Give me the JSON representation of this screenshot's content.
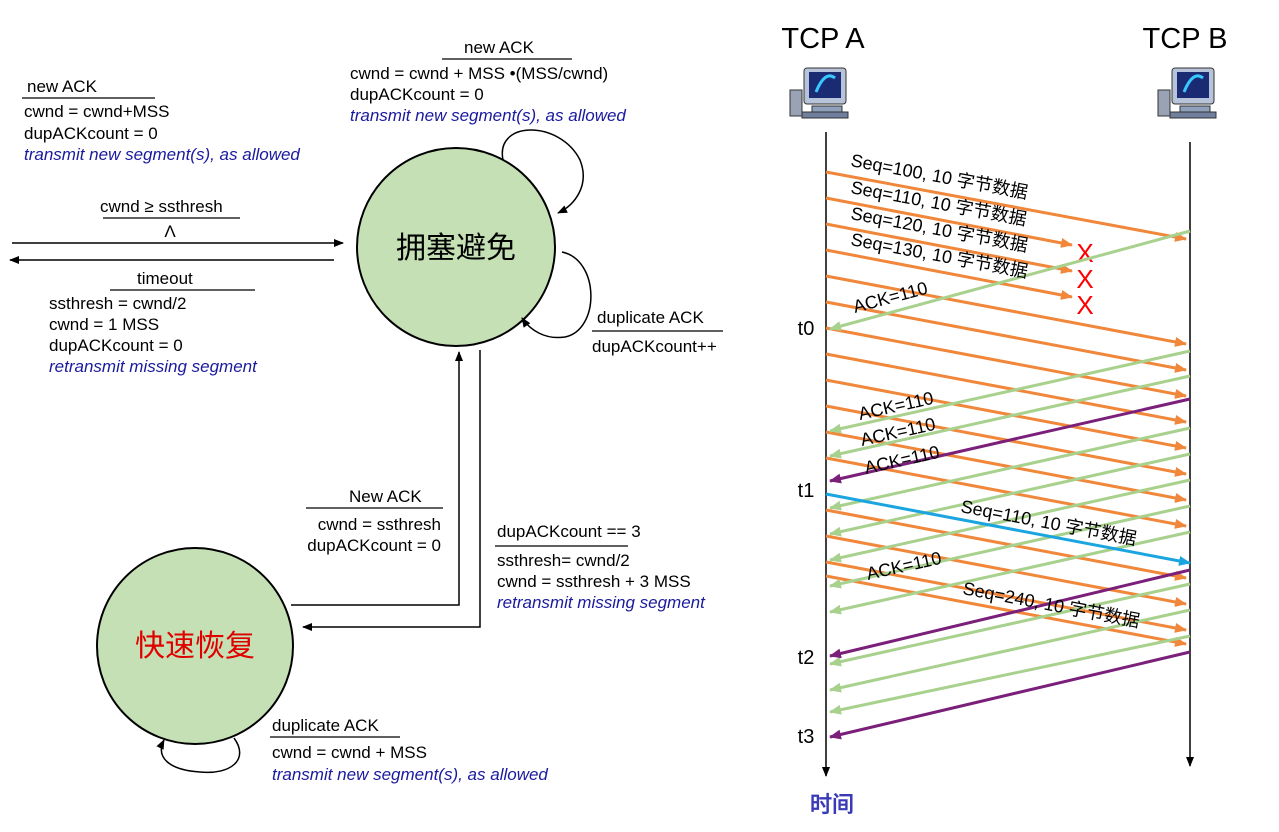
{
  "fsm": {
    "ca_state": "拥塞避免",
    "fr_state": "快速恢复",
    "top_left": {
      "event": "new ACK",
      "a1": "cwnd = cwnd+MSS",
      "a2": "dupACKcount = 0",
      "a3": "transmit new segment(s), as allowed"
    },
    "top_self": {
      "event": "new ACK",
      "a1": "cwnd = cwnd + MSS  •(MSS/cwnd)",
      "a2": "dupACKcount = 0",
      "a3": "transmit new segment(s), as allowed"
    },
    "entry": {
      "event": "cwnd ≥ ssthresh",
      "action": "Λ"
    },
    "timeout": {
      "event": "timeout",
      "a1": "ssthresh = cwnd/2",
      "a2": "cwnd = 1 MSS",
      "a3": "dupACKcount = 0",
      "a4": "retransmit missing segment"
    },
    "dup_ca": {
      "event": "duplicate ACK",
      "action": "dupACKcount++"
    },
    "new_ack_fr": {
      "event": "New ACK",
      "a1": "cwnd = ssthresh",
      "a2": "dupACKcount = 0"
    },
    "dup3": {
      "event": "dupACKcount == 3",
      "a1": "ssthresh= cwnd/2",
      "a2": "cwnd = ssthresh + 3 MSS",
      "a3": "retransmit missing segment"
    },
    "dup_fr": {
      "event": "duplicate ACK",
      "a1": "cwnd = cwnd + MSS",
      "a2": "transmit new segment(s), as allowed"
    }
  },
  "timeline": {
    "host_a": "TCP A",
    "host_b": "TCP B",
    "time_label": "时间",
    "t0": "t0",
    "t1": "t1",
    "t2": "t2",
    "t3": "t3",
    "seg1": "Seq=100, 10 字节数据",
    "seg2": "Seq=110, 10 字节数据",
    "seg3": "Seq=120, 10 字节数据",
    "seg4": "Seq=130, 10 字节数据",
    "ack0": "ACK=110",
    "ack1": "ACK=110",
    "ack2": "ACK=110",
    "ack3": "ACK=110",
    "retx": "Seq=110, 10 字节数据",
    "ack4": "ACK=110",
    "seg240": "Seq=240, 10 字节数据",
    "loss_mark": "X",
    "colors": {
      "data": "#f0873a",
      "dup_ack": "#a9d18e",
      "ack_purple": "#7a1f7a",
      "retransmit": "#1aa5e0",
      "loss": "#ff0000"
    }
  }
}
